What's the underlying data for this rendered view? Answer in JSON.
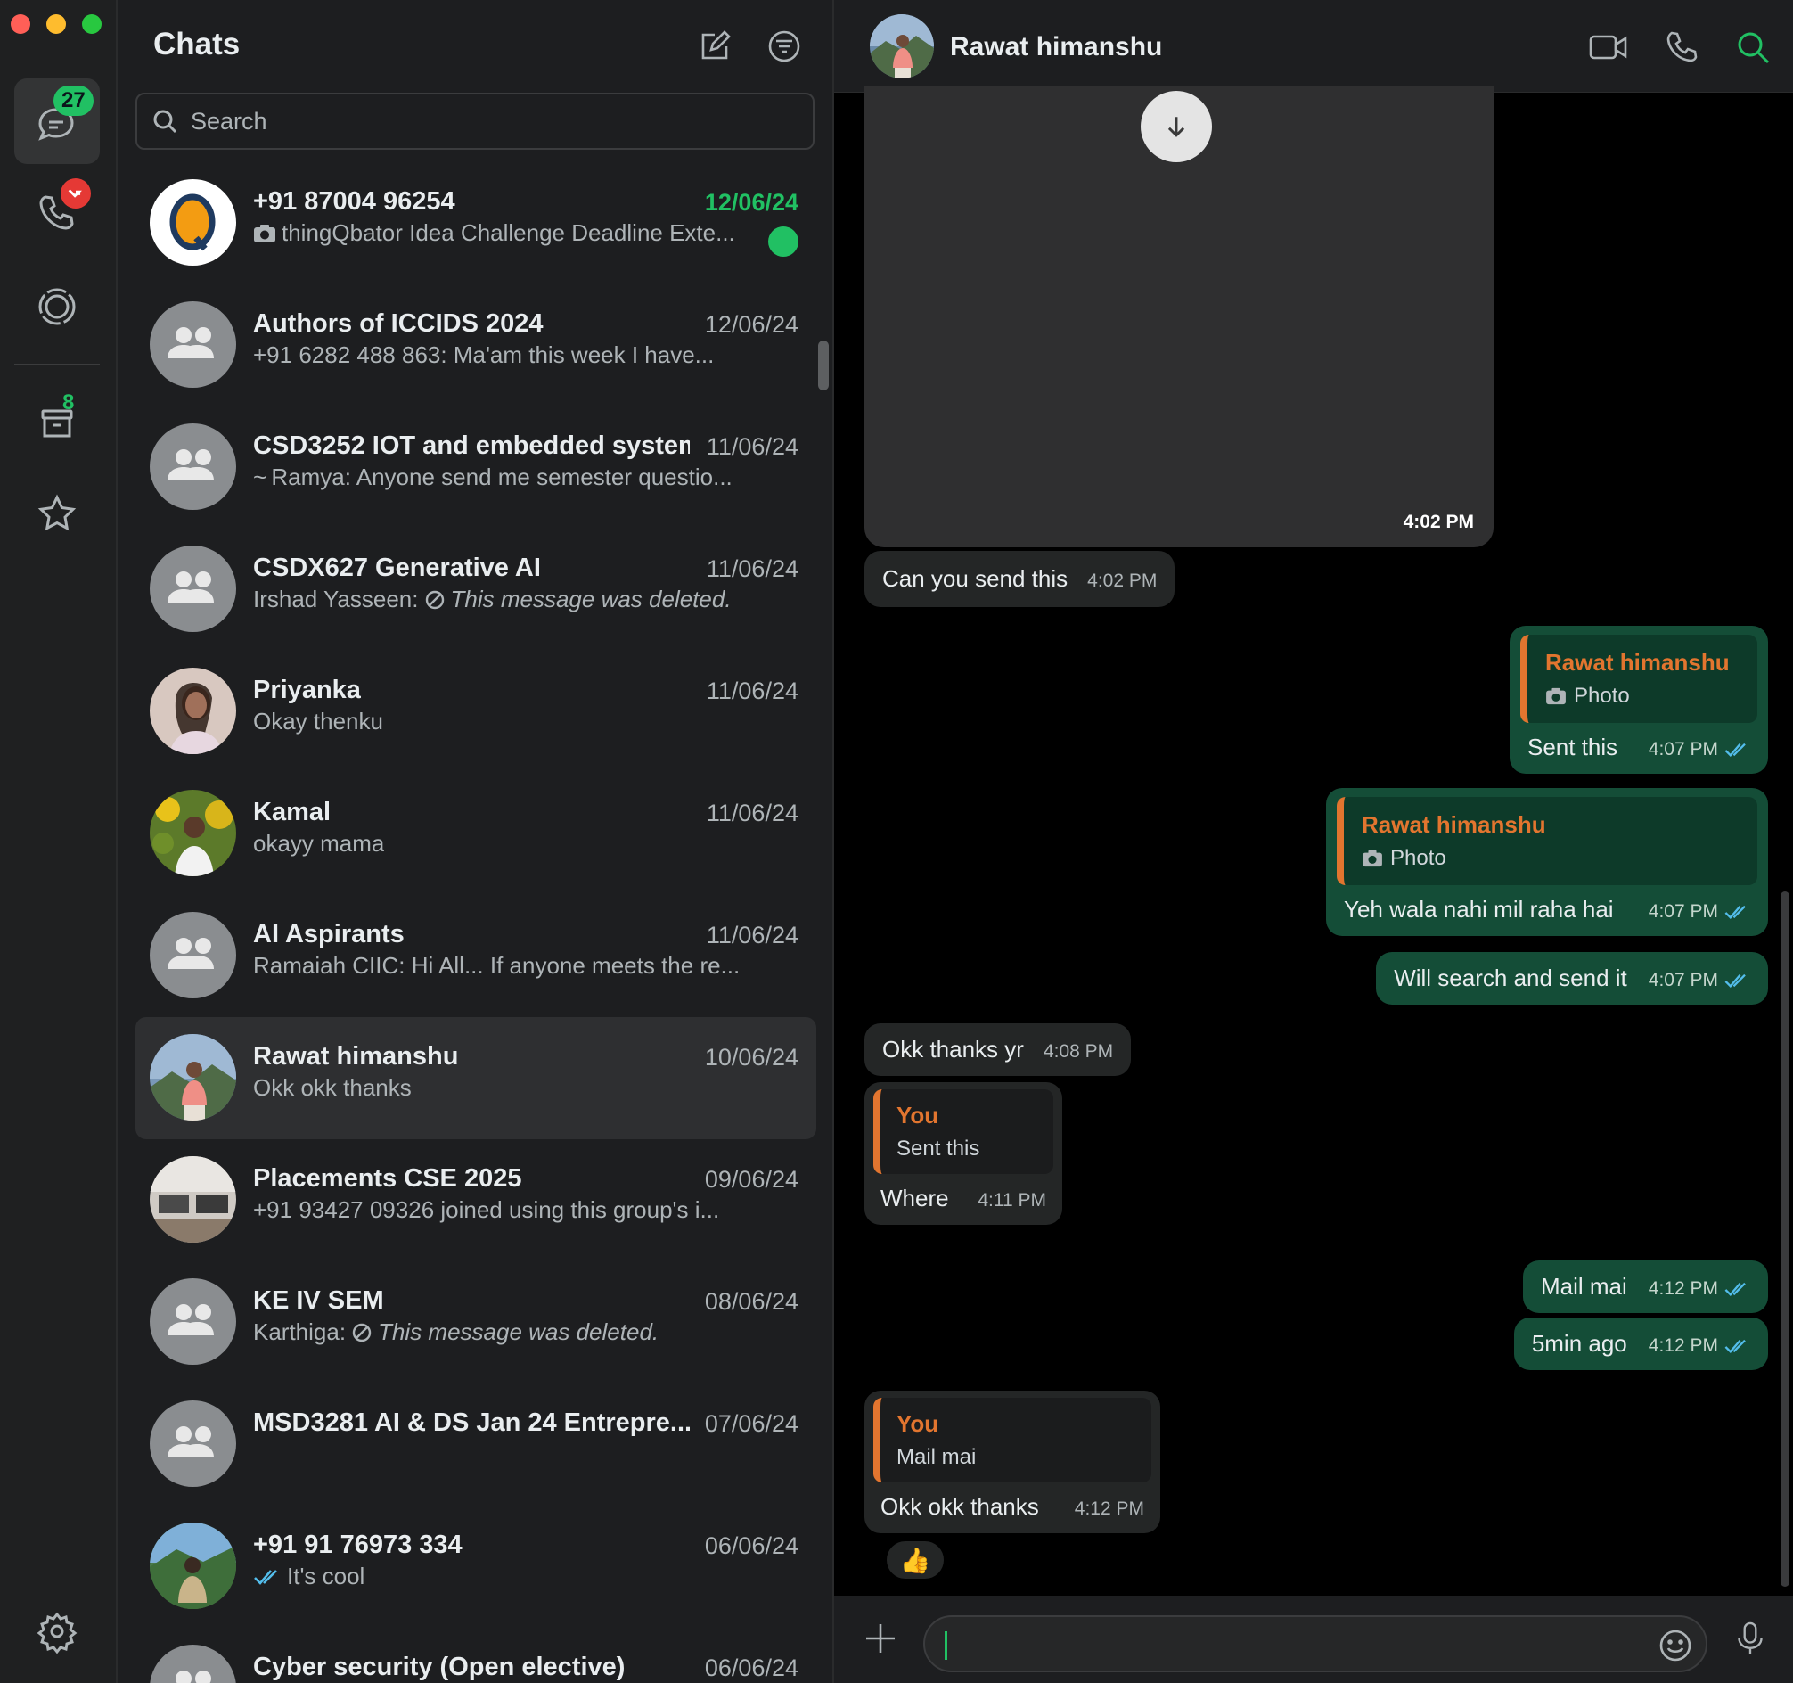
{
  "rail": {
    "chats_badge": "27",
    "archived_badge": "8"
  },
  "list": {
    "title": "Chats",
    "search_placeholder": "Search",
    "rows": [
      {
        "name": "+91 87004 96254",
        "date": "12/06/24",
        "preview": "thingQbator Idea Challenge Deadline Exte...",
        "unread": true,
        "preview_icon": "camera-icon"
      },
      {
        "name": "Authors of ICCIDS 2024",
        "date": "12/06/24",
        "preview": "+91 6282 488 863: Ma'am this week I have..."
      },
      {
        "name": "CSD3252 IOT and embedded system",
        "date": "11/06/24",
        "preview": "~ Ramya: Anyone send me semester questio..."
      },
      {
        "name": "CSDX627 Generative AI",
        "date": "11/06/24",
        "preview_sender": "Irshad Yasseen:",
        "preview": "This message was deleted.",
        "deleted": true
      },
      {
        "name": "Priyanka",
        "date": "11/06/24",
        "preview": "Okay thenku"
      },
      {
        "name": "Kamal",
        "date": "11/06/24",
        "preview": "okayy mama"
      },
      {
        "name": "AI Aspirants",
        "date": "11/06/24",
        "preview": "Ramaiah CIIC: Hi All... If anyone meets the re..."
      },
      {
        "name": "Rawat himanshu",
        "date": "10/06/24",
        "preview": "Okk okk thanks",
        "selected": true
      },
      {
        "name": "Placements CSE 2025",
        "date": "09/06/24",
        "preview": "+91 93427 09326 joined using this group's i..."
      },
      {
        "name": "KE IV SEM",
        "date": "08/06/24",
        "preview_sender": "Karthiga:",
        "preview": "This message was deleted.",
        "deleted": true
      },
      {
        "name": "MSD3281 AI & DS Jan 24 Entrepre...",
        "date": "07/06/24",
        "preview": ""
      },
      {
        "name": "+91 91 76973 334",
        "date": "06/06/24",
        "preview": "It's cool",
        "read_ticks": true
      },
      {
        "name": "Cyber security (Open elective)",
        "date": "06/06/24",
        "preview": ""
      }
    ]
  },
  "conversation": {
    "contact_name": "Rawat himanshu",
    "image_time": "4:02 PM",
    "messages": {
      "m1": {
        "text": "Can you send this",
        "time": "4:02 PM"
      },
      "m2": {
        "quote_name": "Rawat himanshu",
        "quote_text": "Photo",
        "text": "Sent this",
        "time": "4:07 PM"
      },
      "m3": {
        "quote_name": "Rawat himanshu",
        "quote_text": "Photo",
        "text": "Yeh wala nahi mil raha hai",
        "time": "4:07 PM"
      },
      "m4": {
        "text": "Will search and send it",
        "time": "4:07 PM"
      },
      "m5": {
        "text": "Okk thanks yr",
        "time": "4:08 PM"
      },
      "m6": {
        "quote_name": "You",
        "quote_text": "Sent this",
        "text": "Where",
        "time": "4:11 PM"
      },
      "m7": {
        "text": "Mail mai",
        "time": "4:12 PM"
      },
      "m8": {
        "text": "5min ago",
        "time": "4:12 PM"
      },
      "m9": {
        "quote_name": "You",
        "quote_text": "Mail mai",
        "text": "Okk okk thanks",
        "time": "4:12 PM",
        "reaction": "👍"
      }
    }
  },
  "colors": {
    "accent_green": "#21c063",
    "outgoing_bubble": "#144d37",
    "incoming_bubble": "#242626",
    "quote_orange": "#e2752f",
    "read_tick_blue": "#53bdeb"
  }
}
